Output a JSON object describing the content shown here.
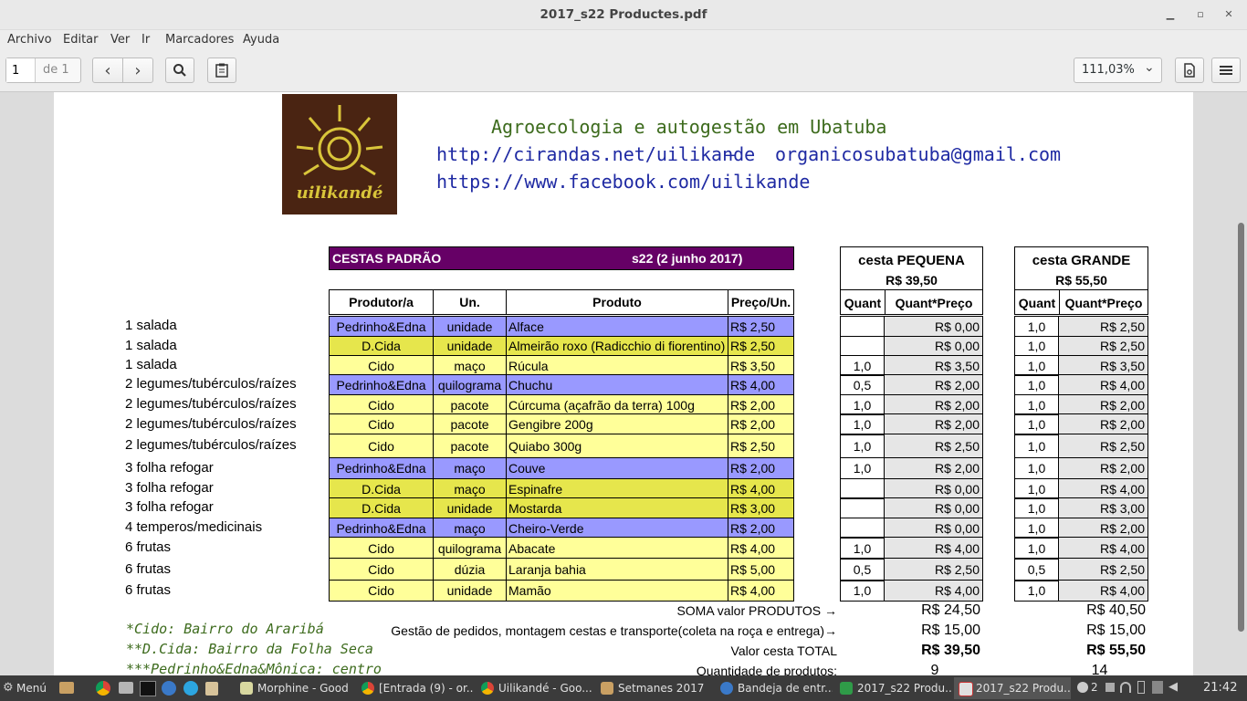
{
  "window": {
    "title": "2017_s22 Productes.pdf"
  },
  "menu": [
    "Archivo",
    "Editar",
    "Ver",
    "Ir",
    "Marcadores",
    "Ayuda"
  ],
  "toolbar": {
    "page_value": "1",
    "page_total": "de 1",
    "zoom": "111,03%"
  },
  "header": {
    "logo_text": "uilikandé",
    "line1": "Agroecologia e autogestão em Ubatuba",
    "line2a": "http://cirandas.net/uilikande",
    "line2sep": "–",
    "line2b": "organicosubatuba@gmail.com",
    "line3": "https://www.facebook.com/uilikande"
  },
  "banner": {
    "left": "CESTAS PADRÃO",
    "right": "s22 (2 junho 2017)"
  },
  "columns": {
    "prod": "Produtor/a",
    "un": "Un.",
    "produto": "Produto",
    "preco": "Preço/Un."
  },
  "small": {
    "title": "cesta PEQUENA",
    "price": "R$ 39,50",
    "q": "Quant",
    "qp": "Quant*Preço"
  },
  "large": {
    "title": "cesta GRANDE",
    "price": "R$ 55,50",
    "q": "Quant",
    "qp": "Quant*Preço"
  },
  "colors": {
    "blue": "#9999ff",
    "dyellow": "#e6e64c",
    "lyellow": "#ffff99",
    "grey": "#e6e6e6",
    "banner": "#660066"
  },
  "rows": [
    {
      "cat": "1 salada",
      "prod": "Pedrinho&Edna",
      "un": "unidade",
      "produto": "Alface",
      "preco": "R$ 2,50",
      "color": "blue",
      "sq": "",
      "sqp": "R$ 0,00",
      "lq": "1,0",
      "lqp": "R$ 2,50"
    },
    {
      "cat": "1 salada",
      "prod": "D.Cida",
      "un": "unidade",
      "produto": "Almeirão roxo (Radicchio di fiorentino)",
      "preco": "R$ 2,50",
      "color": "dyellow",
      "sq": "",
      "sqp": "R$ 0,00",
      "lq": "1,0",
      "lqp": "R$ 2,50"
    },
    {
      "cat": "1 salada",
      "prod": "Cido",
      "un": "maço",
      "produto": "Rúcula",
      "preco": "R$ 3,50",
      "color": "lyellow",
      "sq": "1,0",
      "sqp": "R$ 3,50",
      "lq": "1,0",
      "lqp": "R$ 3,50"
    },
    {
      "cat": "2 legumes/tubérculos/raízes",
      "prod": "Pedrinho&Edna",
      "un": "quilograma",
      "produto": "Chuchu",
      "preco": "R$ 4,00",
      "color": "blue",
      "sq": "0,5",
      "sqp": "R$ 2,00",
      "lq": "1,0",
      "lqp": "R$ 4,00"
    },
    {
      "cat": "2 legumes/tubérculos/raízes",
      "prod": "Cido",
      "un": "pacote",
      "produto": "Cúrcuma (açafrão da terra) 100g",
      "preco": "R$ 2,00",
      "color": "lyellow",
      "sq": "1,0",
      "sqp": "R$ 2,00",
      "lq": "1,0",
      "lqp": "R$ 2,00"
    },
    {
      "cat": "2 legumes/tubérculos/raízes",
      "prod": "Cido",
      "un": "pacote",
      "produto": "Gengibre 200g",
      "preco": "R$ 2,00",
      "color": "lyellow",
      "sq": "1,0",
      "sqp": "R$ 2,00",
      "lq": "1,0",
      "lqp": "R$ 2,00"
    },
    {
      "cat": "2 legumes/tubérculos/raízes",
      "prod": "Cido",
      "un": "pacote",
      "produto": "Quiabo 300g",
      "preco": "R$ 2,50",
      "color": "lyellow",
      "sq": "1,0",
      "sqp": "R$ 2,50",
      "lq": "1,0",
      "lqp": "R$ 2,50"
    },
    {
      "cat": "3 folha refogar",
      "prod": "Pedrinho&Edna",
      "un": "maço",
      "produto": "Couve",
      "preco": "R$ 2,00",
      "color": "blue",
      "sq": "1,0",
      "sqp": "R$ 2,00",
      "lq": "1,0",
      "lqp": "R$ 2,00"
    },
    {
      "cat": "3 folha refogar",
      "prod": "D.Cida",
      "un": "maço",
      "produto": "Espinafre",
      "preco": "R$ 4,00",
      "color": "dyellow",
      "sq": "",
      "sqp": "R$ 0,00",
      "lq": "1,0",
      "lqp": "R$ 4,00"
    },
    {
      "cat": "3 folha refogar",
      "prod": "D.Cida",
      "un": "unidade",
      "produto": "Mostarda",
      "preco": "R$ 3,00",
      "color": "dyellow",
      "sq": "",
      "sqp": "R$ 0,00",
      "lq": "1,0",
      "lqp": "R$ 3,00"
    },
    {
      "cat": "4 temperos/medicinais",
      "prod": "Pedrinho&Edna",
      "un": "maço",
      "produto": "Cheiro-Verde",
      "preco": "R$ 2,00",
      "color": "blue",
      "sq": "",
      "sqp": "R$ 0,00",
      "lq": "1,0",
      "lqp": "R$ 2,00"
    },
    {
      "cat": "6 frutas",
      "prod": "Cido",
      "un": "quilograma",
      "produto": "Abacate",
      "preco": "R$ 4,00",
      "color": "lyellow",
      "sq": "1,0",
      "sqp": "R$ 4,00",
      "lq": "1,0",
      "lqp": "R$ 4,00"
    },
    {
      "cat": "6 frutas",
      "prod": "Cido",
      "un": "dúzia",
      "produto": "Laranja bahia",
      "preco": "R$ 5,00",
      "color": "lyellow",
      "sq": "0,5",
      "sqp": "R$ 2,50",
      "lq": "0,5",
      "lqp": "R$ 2,50"
    },
    {
      "cat": "6 frutas",
      "prod": "Cido",
      "un": "unidade",
      "produto": "Mamão",
      "preco": "R$ 4,00",
      "color": "lyellow",
      "sq": "1,0",
      "sqp": "R$ 4,00",
      "lq": "1,0",
      "lqp": "R$ 4,00"
    }
  ],
  "summary": [
    {
      "label": "SOMA valor PRODUTOS →",
      "small": "R$ 24,50",
      "large": "R$ 40,50",
      "bold": false
    },
    {
      "label": "Gestão de pedidos, montagem cestas e transporte(coleta na roça e entrega)→",
      "small": "R$ 15,00",
      "large": "R$ 15,00",
      "bold": false
    },
    {
      "label": "Valor cesta TOTAL",
      "small": "R$ 39,50",
      "large": "R$ 55,50",
      "bold": true
    },
    {
      "label": "Quantidade de produtos:",
      "small": "9",
      "large": "14",
      "bold": false
    }
  ],
  "notes": [
    "*Cido: Bairro do Araribá",
    "**D.Cida: Bairro da Folha Seca",
    "***Pedrinho&Edna&Mônica: centro"
  ],
  "taskbar": {
    "menu": "Menú",
    "tasks": [
      "Morphine - Good",
      "[Entrada (9) - or...",
      "Uilikandé - Goo...",
      "Setmanes 2017",
      "Bandeja de entr...",
      "2017_s22 Produ...",
      "2017_s22 Produ..."
    ],
    "notif": "2",
    "clock": "21:42"
  }
}
